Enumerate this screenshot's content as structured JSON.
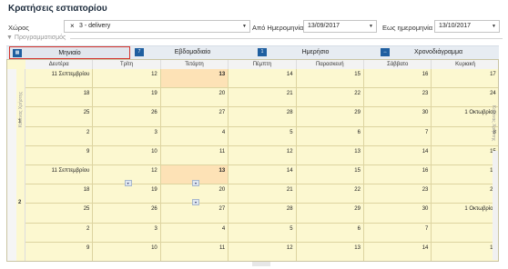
{
  "title": "Κρατήσεις εστιατορίου",
  "filters": {
    "space_label": "Χώρος",
    "space_value": "3 - delivery",
    "from_label": "Από Ημερομηνία",
    "from_value": "13/09/2017",
    "to_label": "Εως ημερομηνία",
    "to_value": "13/10/2017"
  },
  "programming_label": "Προγραμματισμός",
  "views": [
    {
      "label": "Μηνιαίο",
      "icon": "calendar-month-icon",
      "active": true
    },
    {
      "label": "Εβδομαδιαίο",
      "icon": "calendar-week-icon",
      "active": false
    },
    {
      "label": "Ημερήσιο",
      "icon": "calendar-day-icon",
      "active": false
    },
    {
      "label": "Χρονοδιάγραμμα",
      "icon": "timeline-icon",
      "active": false
    }
  ],
  "days": [
    "Δευτέρα",
    "Τρίτη",
    "Τετάρτη",
    "Πέμπτη",
    "Παρασκευή",
    "Σάββατο",
    "Κυριακή"
  ],
  "resource_group_label": "Κανένας Χρήστης",
  "resource_group_label_right": "Κανένας Χρήστης",
  "group_numbers": [
    "1",
    "2"
  ],
  "weeks_group1": [
    [
      "11 Σεπτεμβρίου",
      "12",
      "13",
      "14",
      "15",
      "16",
      "17"
    ],
    [
      "18",
      "19",
      "20",
      "21",
      "22",
      "23",
      "24"
    ],
    [
      "25",
      "26",
      "27",
      "28",
      "29",
      "30",
      "1 Οκτωβρίου"
    ],
    [
      "2",
      "3",
      "4",
      "5",
      "6",
      "7",
      "8"
    ],
    [
      "9",
      "10",
      "11",
      "12",
      "13",
      "14",
      "15"
    ]
  ],
  "weeks_group2": [
    [
      "11 Σεπτεμβρίου",
      "12",
      "13",
      "14",
      "15",
      "16",
      "17"
    ],
    [
      "18",
      "19",
      "20",
      "21",
      "22",
      "23",
      "24"
    ],
    [
      "25",
      "26",
      "27",
      "28",
      "29",
      "30",
      "1 Οκτωβρίου"
    ],
    [
      "2",
      "3",
      "4",
      "5",
      "6",
      "7",
      "8"
    ],
    [
      "9",
      "10",
      "11",
      "12",
      "13",
      "14",
      "15"
    ]
  ],
  "colors": {
    "calendar_bg": "#fcf8d0",
    "highlight": "#fde2b6",
    "accent_border": "#d3332c",
    "icon_blue": "#1f5fa0"
  }
}
